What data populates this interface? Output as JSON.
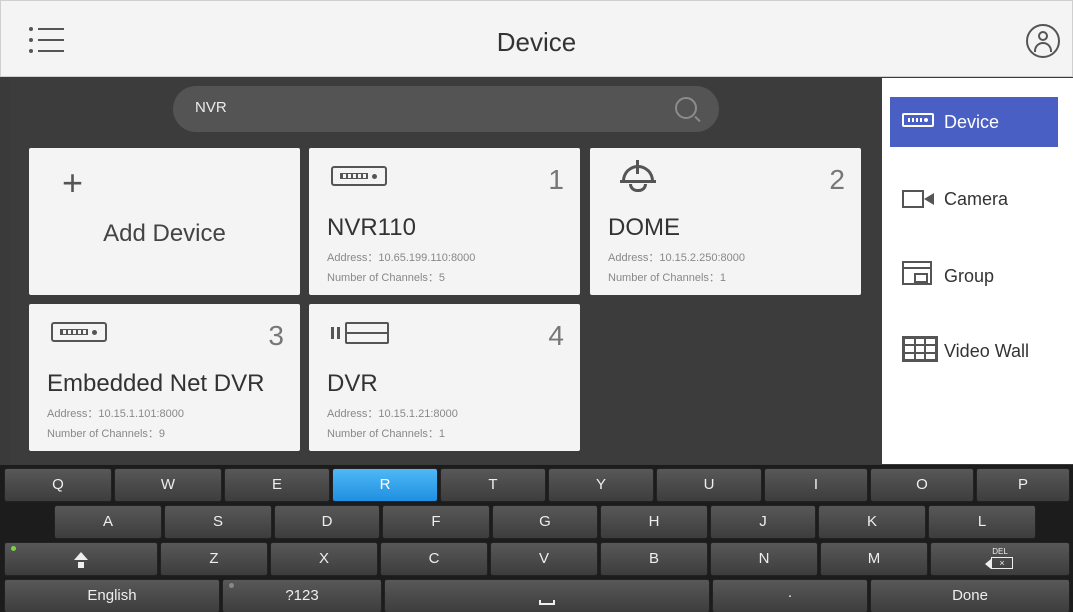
{
  "header": {
    "title": "Device",
    "menu_icon": "menu-icon",
    "user_icon": "user-icon"
  },
  "search": {
    "value": "NVR"
  },
  "add_card": {
    "label": "Add Device",
    "icon": "plus-icon"
  },
  "devices": [
    {
      "index": "1",
      "name": "NVR110",
      "address": "Address：10.65.199.110:8000",
      "channels": "Number of Channels：5",
      "icon": "recorder-icon"
    },
    {
      "index": "2",
      "name": "DOME",
      "address": "Address：10.15.2.250:8000",
      "channels": "Number of Channels：1",
      "icon": "dome-camera-icon"
    },
    {
      "index": "3",
      "name": "Embedded Net DVR",
      "address": "Address：10.15.1.101:8000",
      "channels": "Number of Channels：9",
      "icon": "recorder-icon"
    },
    {
      "index": "4",
      "name": "DVR",
      "address": "Address：10.15.1.21:8000",
      "channels": "Number of Channels：1",
      "icon": "dvr-icon"
    }
  ],
  "sidebar": {
    "items": [
      {
        "label": "Device",
        "icon": "device-icon",
        "active": true
      },
      {
        "label": "Camera",
        "icon": "camera-icon",
        "active": false
      },
      {
        "label": "Group",
        "icon": "group-icon",
        "active": false
      },
      {
        "label": "Video Wall",
        "icon": "video-wall-icon",
        "active": false
      }
    ],
    "accent_color": "#4a5fc4"
  },
  "keyboard": {
    "row1": [
      "Q",
      "W",
      "E",
      "R",
      "T",
      "Y",
      "U",
      "I",
      "O",
      "P"
    ],
    "row2": [
      "A",
      "S",
      "D",
      "F",
      "G",
      "H",
      "J",
      "K",
      "L"
    ],
    "row3": [
      "Z",
      "X",
      "C",
      "V",
      "B",
      "N",
      "M"
    ],
    "del_label": "DEL",
    "del_glyph": "×",
    "language": "English",
    "symbols": "?123",
    "period": "·",
    "done": "Done",
    "active_key": "R",
    "active_color": "#1f8fe0"
  }
}
